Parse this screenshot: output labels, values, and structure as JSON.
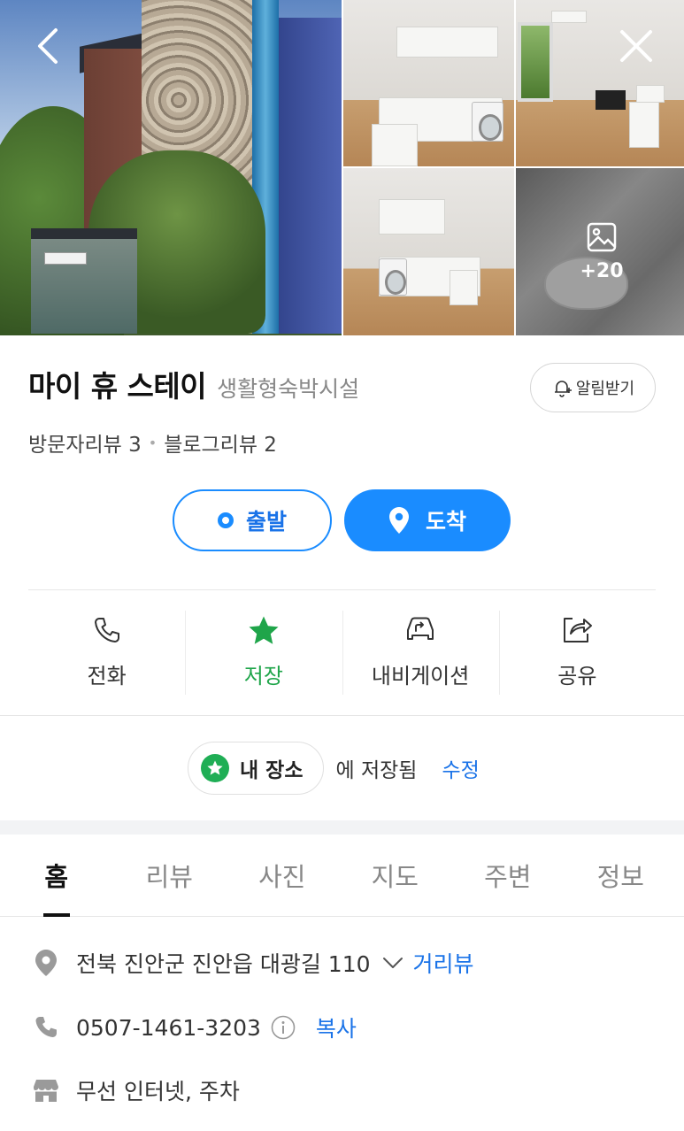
{
  "photos": {
    "more_count": "+20"
  },
  "place": {
    "name": "마이 휴 스테이",
    "category": "생활형숙박시설",
    "alarm_label": "알림받기",
    "visitor_reviews": "방문자리뷰 3",
    "blog_reviews": "블로그리뷰 2"
  },
  "route": {
    "start_label": "출발",
    "arrive_label": "도착"
  },
  "actions": [
    {
      "label": "전화",
      "icon": "phone-icon"
    },
    {
      "label": "저장",
      "icon": "star-icon"
    },
    {
      "label": "내비게이션",
      "icon": "car-icon"
    },
    {
      "label": "공유",
      "icon": "share-icon"
    }
  ],
  "saved": {
    "chip_label": "내 장소",
    "text": "에 저장됨",
    "edit_label": "수정"
  },
  "tabs": [
    "홈",
    "리뷰",
    "사진",
    "지도",
    "주변",
    "정보"
  ],
  "info": {
    "address": "전북 진안군 진안읍 대광길 110",
    "street_view": "거리뷰",
    "phone": "0507-1461-3203",
    "copy": "복사",
    "facilities": "무선 인터넷, 주차"
  },
  "colors": {
    "accent": "#1a8cff",
    "green": "#1fa54a"
  }
}
